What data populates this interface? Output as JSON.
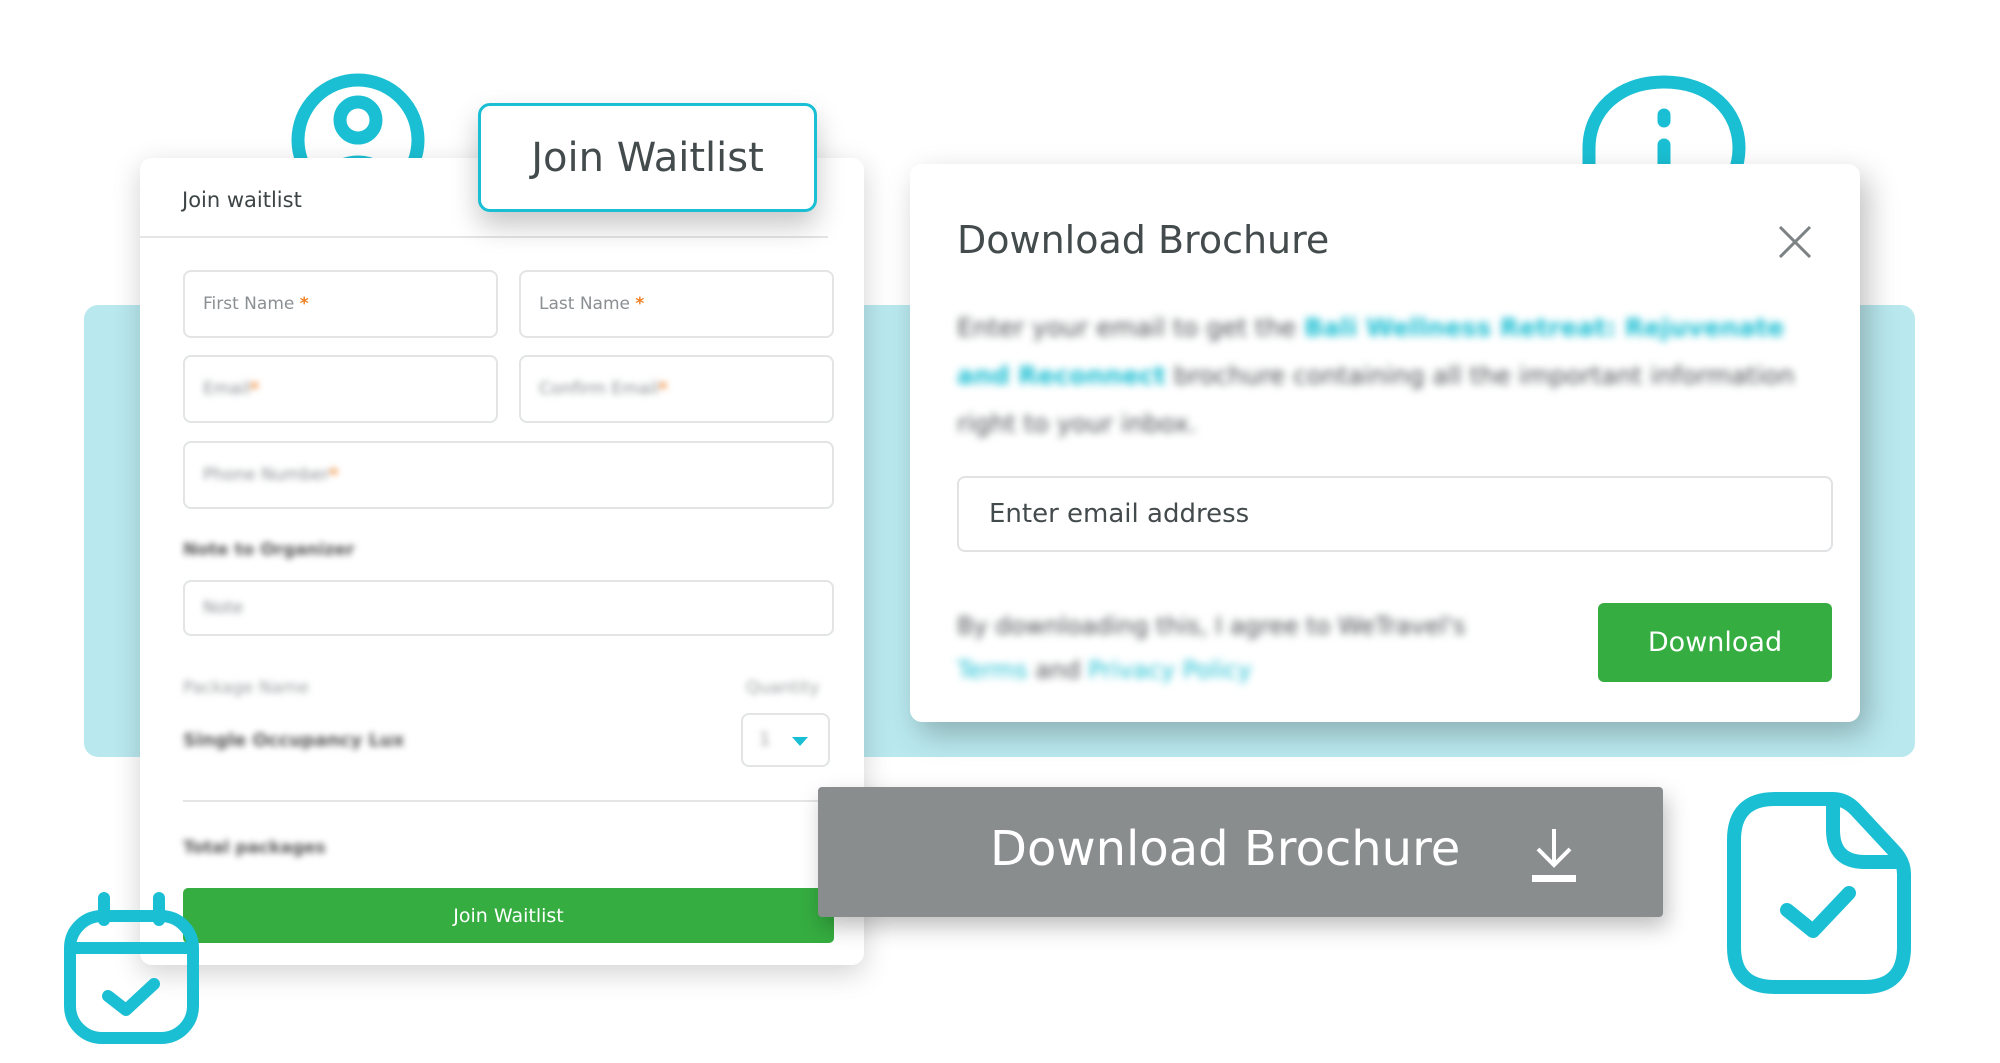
{
  "colors": {
    "accent_teal": "#1bbfd3",
    "band_teal": "#b9e9ef",
    "primary_green": "#35ad40",
    "required_orange": "#f07f22",
    "gray_bar": "#8a8d8e"
  },
  "decorative_icons": [
    "user-icon",
    "info-icon",
    "file-check-icon",
    "calendar-check-icon"
  ],
  "callout_join": {
    "label": "Join Waitlist"
  },
  "waitlist_form": {
    "heading": "Join waitlist",
    "fields": {
      "first_name": {
        "label": "First Name",
        "required_mark": "*"
      },
      "last_name": {
        "label": "Last Name",
        "required_mark": "*"
      },
      "email": {
        "label": "Email",
        "required_mark": "*"
      },
      "confirm_email": {
        "label": "Confirm Email",
        "required_mark": "*"
      },
      "phone": {
        "label": "Phone Number",
        "required_mark": "*"
      }
    },
    "note_label": "Note to Organizer",
    "note_placeholder": "Note",
    "package_header": "Package Name",
    "quantity_header": "Quantity",
    "package_name": "Single Occupancy Lux",
    "quantity_value": "1",
    "total_label": "Total packages",
    "submit_label": "Join Waitlist"
  },
  "brochure_modal": {
    "title": "Download Brochure",
    "description_prefix": "Enter your email to get the ",
    "description_link": "Bali Wellness Retreat: Rejuvenate and Reconnect",
    "description_suffix": " brochure containing all the important information right to your inbox.",
    "email_placeholder": "Enter email address",
    "consent_prefix": "By downloading this, I agree to WeTravel's ",
    "consent_terms": "Terms",
    "consent_and": " and ",
    "consent_privacy": "Privacy Policy",
    "download_label": "Download"
  },
  "brochure_bar": {
    "label": "Download Brochure",
    "icon": "download-icon"
  }
}
